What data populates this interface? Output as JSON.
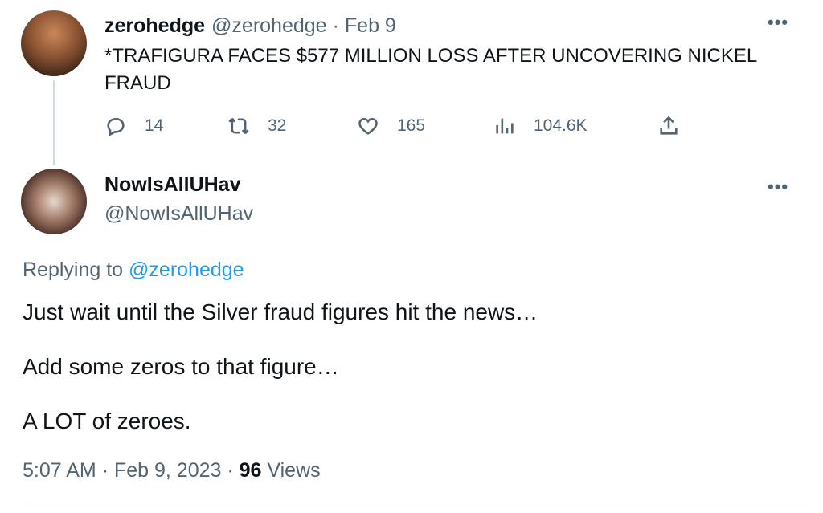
{
  "parent_tweet": {
    "display_name": "zerohedge",
    "handle": "@zerohedge",
    "separator": "·",
    "date": "Feb 9",
    "text": "*TRAFIGURA FACES $577 MILLION LOSS AFTER UNCOVERING NICKEL FRAUD",
    "actions": {
      "replies": "14",
      "retweets": "32",
      "likes": "165",
      "views": "104.6K"
    },
    "icons": [
      "reply-icon",
      "retweet-icon",
      "like-icon",
      "views-icon",
      "share-icon",
      "more-icon"
    ]
  },
  "reply_tweet": {
    "display_name": "NowIsAllUHav",
    "handle": "@NowIsAllUHav",
    "replying_prefix": "Replying to",
    "replying_to": "@zerohedge",
    "lines": [
      "Just wait until the Silver fraud figures hit the news…",
      "Add some zeros to that figure…",
      "A LOT of zeroes."
    ],
    "timestamp": "5:07 AM",
    "separator": "·",
    "date": "Feb 9, 2023",
    "views_count": "96",
    "views_label": "Views"
  },
  "colors": {
    "text": "#0f1419",
    "muted": "#536471",
    "link": "#1d9bf0",
    "thread_line": "#cfd9de"
  }
}
